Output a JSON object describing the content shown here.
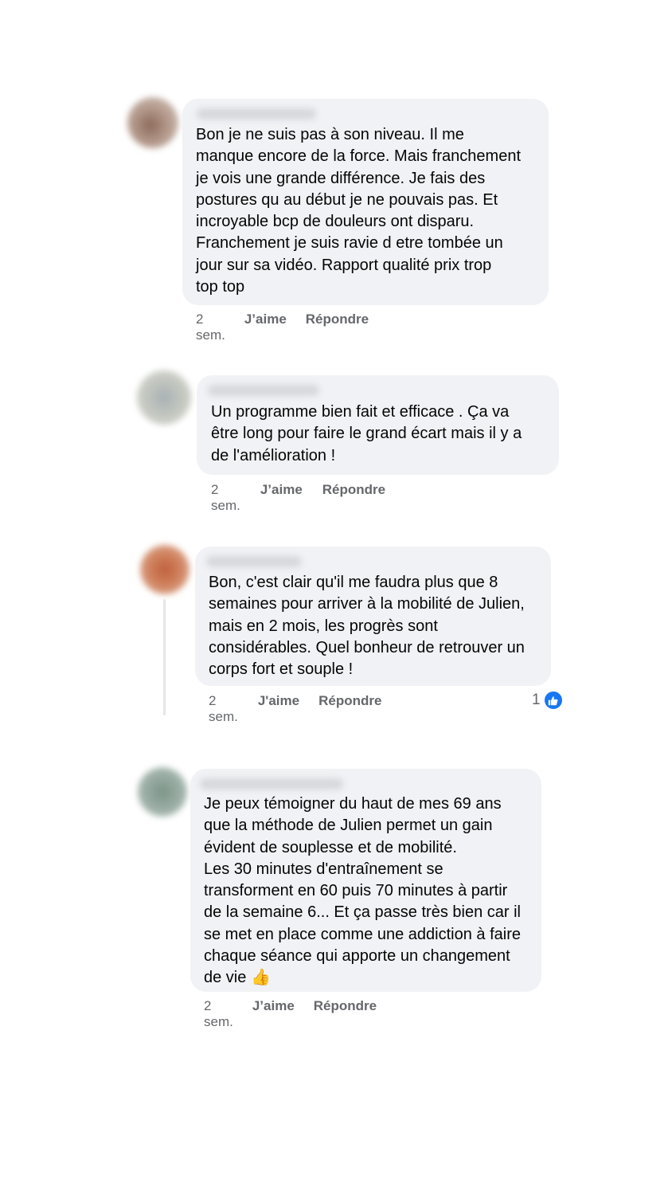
{
  "comments": [
    {
      "text": "Bon je ne suis pas à  son niveau. Il me\nmanque encore de la force. Mais franchement\nje vois une grande différence. Je fais des\npostures qu au début je ne pouvais pas. Et\nincroyable bcp de douleurs ont disparu.\nFranchement je suis ravie d etre tombée un\njour sur sa vidéo.  Rapport qualité prix trop\ntop top",
      "time": "2 sem.",
      "like_label": "J’aime",
      "reply_label": "Répondre",
      "avatar_color": "#b49a8c"
    },
    {
      "text": "Un programme bien fait et efficace . Ça va\nêtre long pour faire le grand écart mais il y a\nde l'amélioration !",
      "time": "2 sem.",
      "like_label": "J’aime",
      "reply_label": "Répondre",
      "avatar_color": "#b8bcb4"
    },
    {
      "text": "Bon, c'est clair qu'il me faudra plus que 8\nsemaines pour arriver à la mobilité de Julien,\nmais en 2 mois, les progrès sont\nconsidérables. Quel bonheur de retrouver un\ncorps fort et souple !",
      "time": "2 sem.",
      "like_label": "J'aime",
      "reply_label": "Répondre",
      "reaction_count": "1",
      "avatar_color": "#d0825e"
    },
    {
      "text": "Je peux témoigner du haut de mes 69 ans\nque la méthode de Julien permet un gain\névident de souplesse et de mobilité.\nLes 30 minutes d'entraînement se\ntransforment en 60 puis 70 minutes à partir\nde la semaine 6... Et ça passe très bien car il\nse met en place comme une addiction à faire\nchaque séance qui apporte un changement\nde vie",
      "emoji": "👍",
      "time": "2 sem.",
      "like_label": "J’aime",
      "reply_label": "Répondre",
      "avatar_color": "#9aada4"
    }
  ]
}
